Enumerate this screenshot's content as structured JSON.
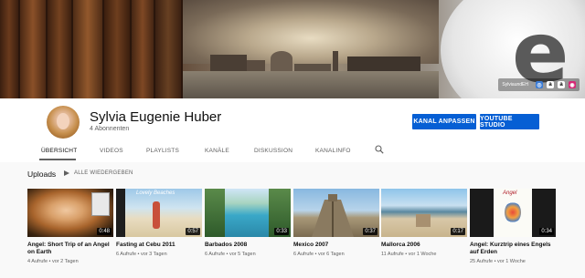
{
  "banner": {
    "links_text": "SylviaundEH",
    "link_icons": [
      {
        "name": "website-icon",
        "color": "#3a7bd5",
        "glyph": "◎"
      },
      {
        "name": "amazon-icon",
        "color": "#ffffff",
        "glyph": "a"
      },
      {
        "name": "amazon-icon-2",
        "color": "#ffffff",
        "glyph": "a"
      },
      {
        "name": "instagram-icon",
        "color": "#d62976",
        "glyph": "◉"
      }
    ]
  },
  "channel": {
    "name": "Sylvia Eugenie Huber",
    "subscribers": "4 Abonnenten",
    "customize_label": "KANAL ANPASSEN",
    "studio_label": "YOUTUBE STUDIO"
  },
  "tabs": [
    {
      "label": "ÜBERSICHT",
      "active": true
    },
    {
      "label": "VIDEOS",
      "active": false
    },
    {
      "label": "PLAYLISTS",
      "active": false
    },
    {
      "label": "KANÄLE",
      "active": false
    },
    {
      "label": "DISKUSSION",
      "active": false
    },
    {
      "label": "KANALINFO",
      "active": false
    }
  ],
  "uploads": {
    "title": "Uploads",
    "play_all": "ALLE WIEDERGEBEN",
    "videos": [
      {
        "title": "Angel: Short Trip of an Angel on Earth",
        "duration": "0:48",
        "meta": "4 Aufrufe • vor 2 Tagen"
      },
      {
        "title": "Fasting at Cebu 2011",
        "duration": "0:57",
        "meta": "6 Aufrufe • vor 3 Tagen"
      },
      {
        "title": "Barbados 2008",
        "duration": "0:33",
        "meta": "6 Aufrufe • vor 5 Tagen"
      },
      {
        "title": "Mexico 2007",
        "duration": "0:37",
        "meta": "6 Aufrufe • vor 6 Tagen"
      },
      {
        "title": "Mallorca 2006",
        "duration": "0:17",
        "meta": "11 Aufrufe • vor 1 Woche"
      },
      {
        "title": "Angel: Kurztrip eines Engels auf Erden",
        "duration": "0:34",
        "meta": "25 Aufrufe • vor 1 Woche"
      }
    ],
    "thumb_texts": {
      "cebu": "Lovely Beaches",
      "angel_de": "Angel"
    }
  },
  "colors": {
    "accent": "#065fd4",
    "text_secondary": "#606060",
    "background": "#f9f9f9"
  }
}
